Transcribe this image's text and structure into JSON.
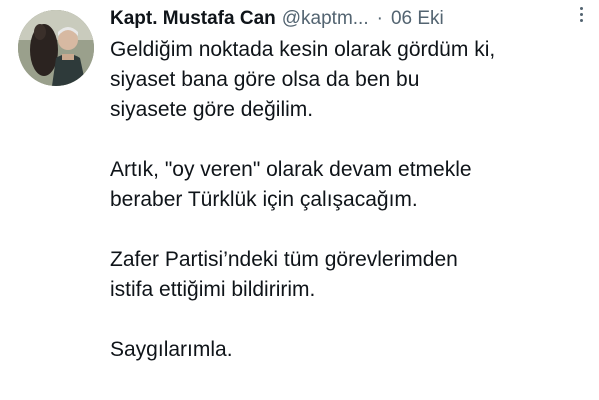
{
  "tweet": {
    "author_name": "Kapt. Mustafa Can",
    "handle": "@kaptm...",
    "separator": "·",
    "date": "06 Eki",
    "paragraphs": [
      {
        "lines": [
          "Geldiğim noktada kesin olarak gördüm ki,",
          "siyaset bana göre olsa da ben bu",
          "siyasete göre değilim."
        ]
      },
      {
        "lines": [
          "Artık, \"oy veren\" olarak devam etmekle",
          "beraber Türklük için çalışacağım."
        ]
      },
      {
        "lines": [
          "Zafer Partisi’ndeki tüm görevlerimden",
          "istifa ettiğimi bildiririm."
        ]
      },
      {
        "lines": [
          "Saygılarımla."
        ]
      }
    ]
  },
  "icons": {
    "more": "more-options-icon",
    "avatar": "profile-photo"
  }
}
